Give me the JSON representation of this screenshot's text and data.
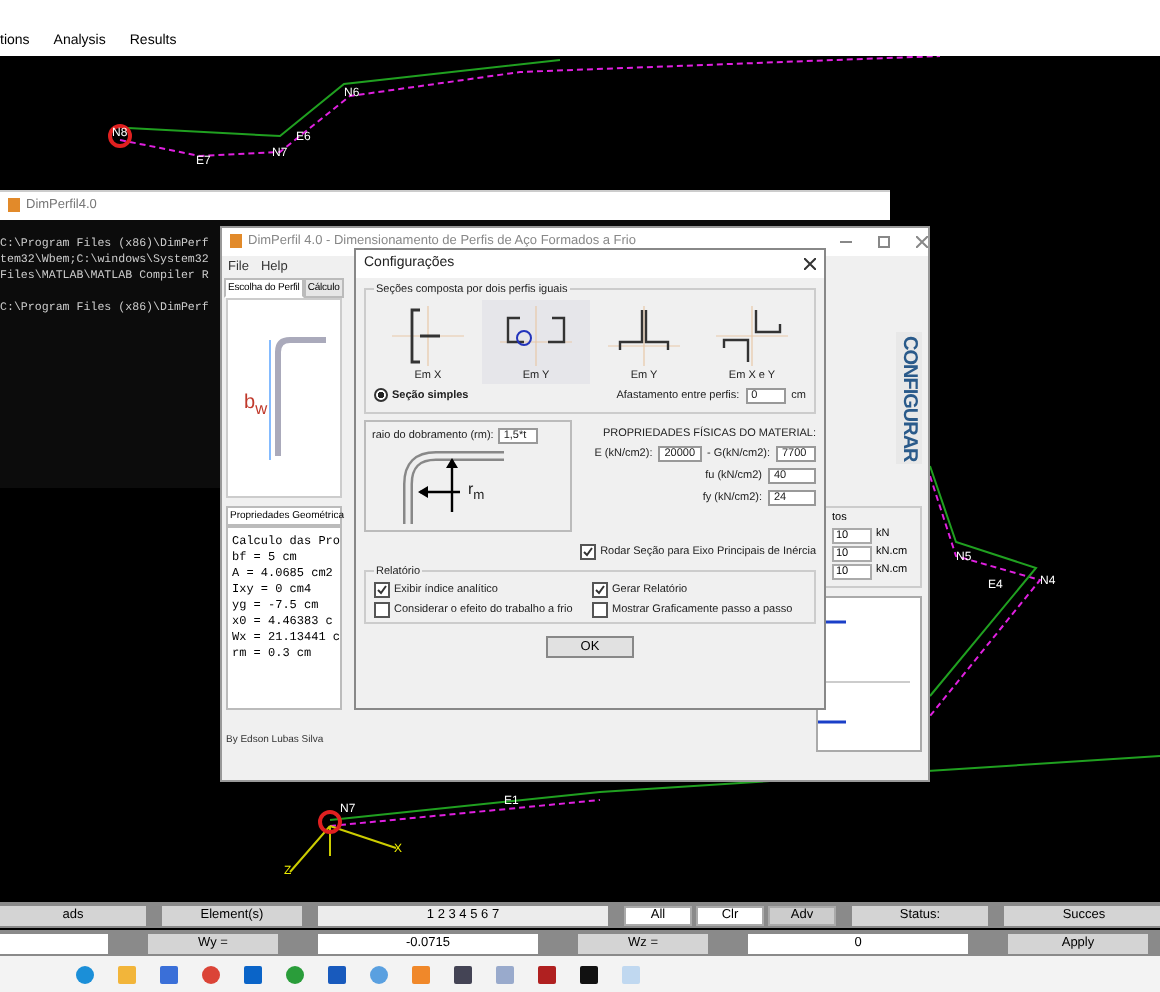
{
  "app_menu": [
    "tions",
    "Analysis",
    "Results"
  ],
  "canvas": {
    "labels": [
      "N8",
      "E7",
      "N7",
      "E6",
      "N6",
      "N5",
      "E4",
      "N4",
      "E1",
      "N7",
      "Z",
      "X"
    ]
  },
  "console": {
    "title": "DimPerfil4.0",
    "lines": [
      "C:\\Program Files (x86)\\DimPerf",
      "tem32\\Wbem;C:\\windows\\System32",
      "Files\\MATLAB\\MATLAB Compiler R"
    ],
    "prompt": "C:\\Program Files (x86)\\DimPerf"
  },
  "main_window": {
    "title": "DimPerfil 4.0 - Dimensionamento de Perfis de Aço Formados a Frio",
    "menu": [
      "File",
      "Help"
    ],
    "tabs": [
      {
        "label": "Escolha do Perfil",
        "selected": true
      },
      {
        "label": "Cálculo",
        "selected": false
      }
    ],
    "profile_label": "b$_{w}$",
    "properties_tab": "Propriedades Geométrica",
    "properties_lines": [
      "Calculo das Pro",
      "bf = 5 cm",
      "A = 4.0685 cm2",
      "Ixy = 0 cm4",
      "yg = -7.5 cm",
      "x0 = 4.46383 c",
      "Wx = 21.13441 c",
      "rm = 0.3 cm"
    ],
    "author": "By Edson Lubas Silva",
    "configure_button": "CONFIGURAR",
    "loads": {
      "header": "tos",
      "rows": [
        {
          "value": "10",
          "unit": "kN"
        },
        {
          "value": "10",
          "unit": "kN.cm"
        },
        {
          "value": "10",
          "unit": "kN.cm"
        }
      ]
    }
  },
  "dialog": {
    "title": "Configurações",
    "sections": {
      "legend": "Seções composta por dois perfis iguais",
      "options": [
        {
          "label": "Em X",
          "kind": "back",
          "selected": false
        },
        {
          "label": "Em Y",
          "kind": "open",
          "selected": true
        },
        {
          "label": "Em Y",
          "kind": "tee",
          "selected": false
        },
        {
          "label": "Em X e Y",
          "kind": "cross",
          "selected": false
        }
      ]
    },
    "simple_section": {
      "label": "Seção simples",
      "selected": true
    },
    "spacing": {
      "label": "Afastamento entre perfis:",
      "value": "0",
      "unit": "cm"
    },
    "bend_radius": {
      "label": "raio do dobramento (rm):",
      "value": "1,5*t",
      "drawing_label": "r$_{m}$"
    },
    "material": {
      "heading": "PROPRIEDADES FÍSICAS DO MATERIAL:",
      "fields": [
        {
          "label": "E (kN/cm2):",
          "value": "20000"
        },
        {
          "label": "- G(kN/cm2):",
          "value": "7700"
        },
        {
          "label": "fu (kN/cm2)",
          "value": "40"
        },
        {
          "label": "fy (kN/cm2):",
          "value": "24"
        }
      ]
    },
    "rotate": {
      "label": "Rodar Seção para Eixo Principais de Inércia",
      "checked": true
    },
    "report": {
      "legend": "Relatório",
      "options": [
        {
          "label": "Exibir índice analítico",
          "checked": true
        },
        {
          "label": "Gerar Relatório",
          "checked": true
        },
        {
          "label": "Considerar o efeito do trabalho a frio",
          "checked": false
        },
        {
          "label": "Mostrar Graficamente passo a passo",
          "checked": false
        }
      ]
    },
    "ok": "OK"
  },
  "bottom_bar": {
    "row1": {
      "loads": "ads",
      "elements": "Element(s)",
      "element_list": "1 2 3 4 5 6 7",
      "buttons": [
        "All",
        "Clr",
        "Adv"
      ],
      "status": "Status:",
      "result": "Succes"
    },
    "row2": {
      "wy_label": "Wy =",
      "wy": "-0.0715",
      "wz_label": "Wz =",
      "wz": "0",
      "apply": "Apply"
    }
  }
}
